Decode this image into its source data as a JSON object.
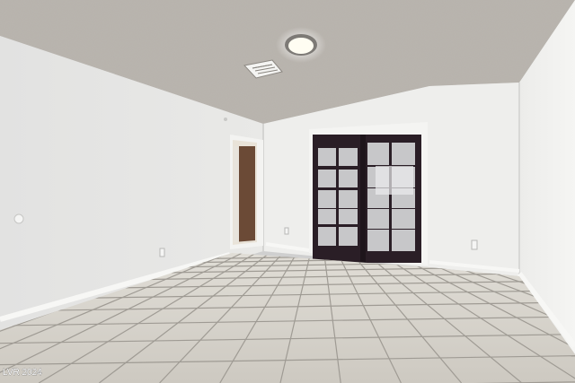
{
  "watermark": {
    "text": "LVR 2024"
  },
  "scene": {
    "room": "empty-room",
    "ceiling": "textured-ceiling",
    "fixtures": [
      "ceiling-light-icon",
      "air-vent-icon"
    ],
    "doors": [
      "french-doors",
      "side-doorway"
    ],
    "floor": "tile-floor",
    "colors": {
      "ceiling": "#b9b4ad",
      "wall_left": "#e5e5e4",
      "wall_back": "#eeeeec",
      "wall_right": "#f1f1ef",
      "floor_tile": "#d6d3cc",
      "grout": "#9a968f",
      "door_frame": "#2a1e26",
      "door_glass": "#c6c6c8",
      "light": "#fffdf2"
    }
  }
}
